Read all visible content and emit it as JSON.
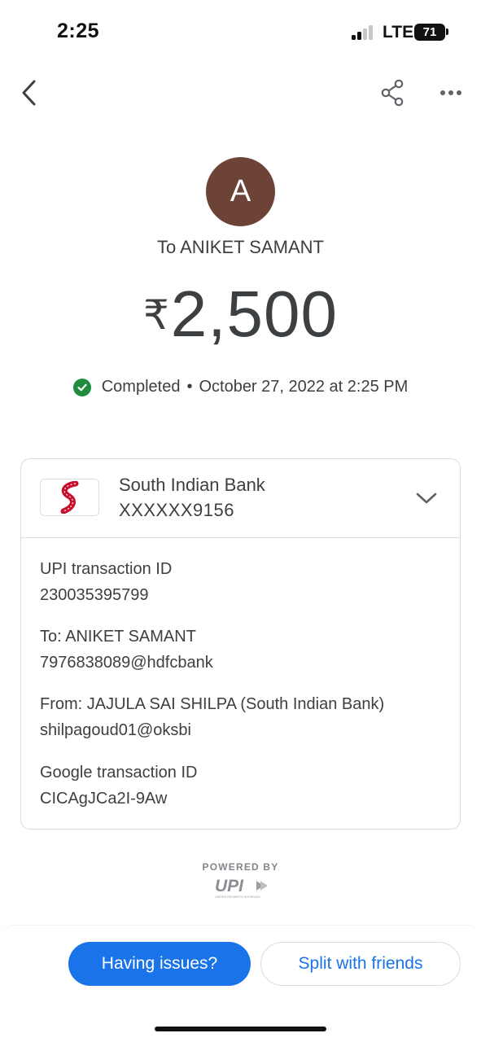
{
  "status_bar": {
    "time": "2:25",
    "network": "LTE",
    "battery": "71"
  },
  "header": {
    "back_icon": "chevron-left-icon",
    "share_icon": "share-icon",
    "more_icon": "more-horizontal-icon"
  },
  "payment": {
    "avatar_initial": "A",
    "avatar_color": "#6d4237",
    "recipient": "To ANIKET SAMANT",
    "currency": "₹",
    "amount": "2,500",
    "status": "Completed",
    "separator": "•",
    "datetime": "October 27, 2022 at 2:25 PM",
    "status_color": "#1e8e3e"
  },
  "bank": {
    "name": "South Indian Bank",
    "account": "XXXXXX9156",
    "logo_icon": "south-indian-bank-logo"
  },
  "details": [
    {
      "label": "UPI transaction ID",
      "value": "230035395799"
    },
    {
      "label": "To: ANIKET SAMANT",
      "value": "7976838089@hdfcbank"
    },
    {
      "label": "From: JAJULA SAI SHILPA (South Indian Bank)",
      "value": "shilpagoud01@oksbi"
    },
    {
      "label": "Google transaction ID",
      "value": "CICAgJCa2I-9Aw"
    }
  ],
  "footer": {
    "powered_by": "POWERED BY",
    "upi_logo": "UPI",
    "upi_tagline": "UNIFIED PAYMENTS INTERFACE"
  },
  "actions": {
    "issues_label": "Having issues?",
    "split_label": "Split with friends",
    "accent": "#1a73e8"
  }
}
